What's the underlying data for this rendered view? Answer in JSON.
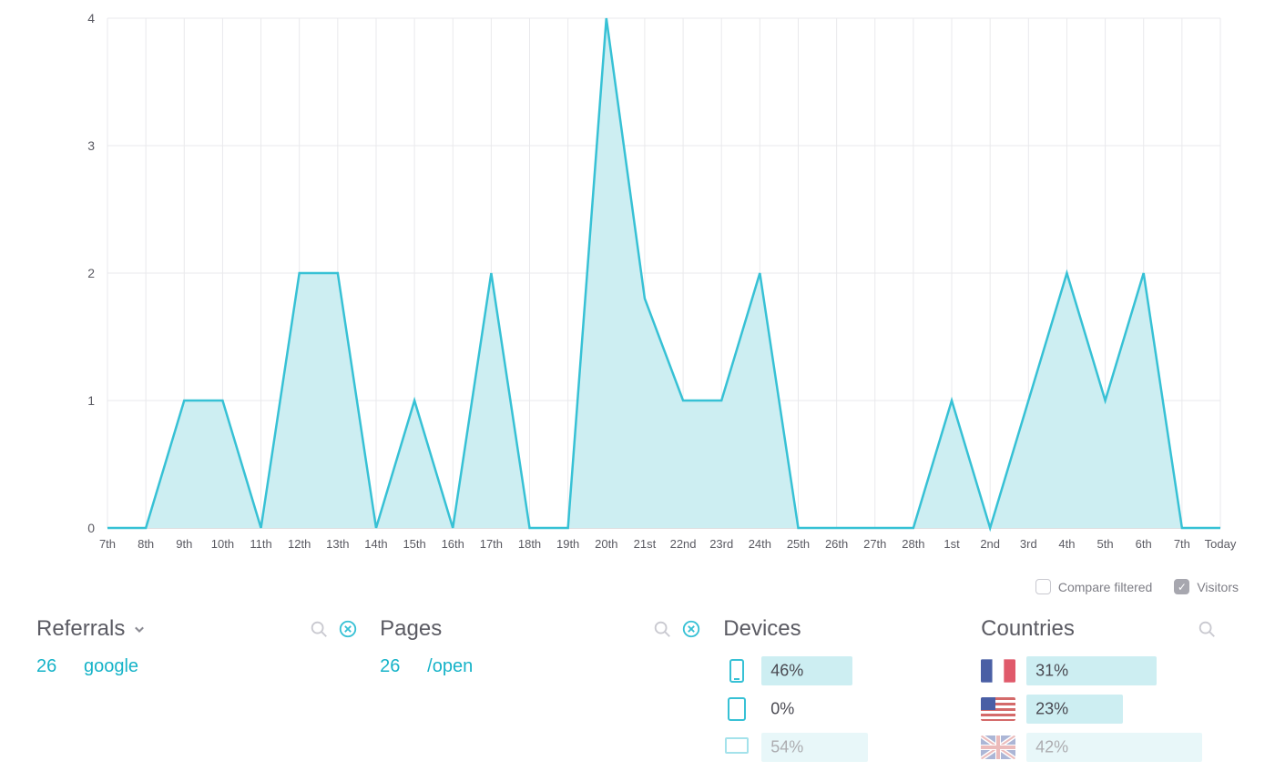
{
  "chart_data": {
    "type": "area",
    "title": "",
    "xlabel": "",
    "ylabel": "",
    "ylim": [
      0,
      4
    ],
    "yticks": [
      0,
      1,
      2,
      3,
      4
    ],
    "categories": [
      "7th",
      "8th",
      "9th",
      "10th",
      "11th",
      "12th",
      "13th",
      "14th",
      "15th",
      "16th",
      "17th",
      "18th",
      "19th",
      "20th",
      "21st",
      "22nd",
      "23rd",
      "24th",
      "25th",
      "26th",
      "27th",
      "28th",
      "1st",
      "2nd",
      "3rd",
      "4th",
      "5th",
      "6th",
      "7th",
      "Today"
    ],
    "values": [
      0,
      0,
      1,
      1,
      0,
      2,
      2,
      0,
      1,
      0,
      2,
      0,
      0,
      4,
      1.8,
      1,
      1,
      2,
      0,
      0,
      0,
      0,
      1,
      0,
      1,
      2,
      1,
      2,
      0,
      0
    ],
    "line_color": "#37c1d5",
    "fill_color": "#cdeef2"
  },
  "legend": {
    "compare": {
      "label": "Compare filtered",
      "checked": false
    },
    "visitors": {
      "label": "Visitors",
      "checked": true
    }
  },
  "panels": {
    "referrals": {
      "title": "Referrals",
      "items": [
        {
          "value": "26",
          "label": "google"
        }
      ]
    },
    "pages": {
      "title": "Pages",
      "items": [
        {
          "value": "26",
          "label": "/open"
        }
      ]
    },
    "devices": {
      "title": "Devices",
      "items": [
        {
          "icon": "mobile",
          "percent": 46,
          "label": "46%"
        },
        {
          "icon": "tablet",
          "percent": 0,
          "label": "0%"
        },
        {
          "icon": "desktop",
          "percent": 54,
          "label": "54%"
        }
      ]
    },
    "countries": {
      "title": "Countries",
      "items": [
        {
          "flag": "fr",
          "percent": 31,
          "label": "31%"
        },
        {
          "flag": "us",
          "percent": 23,
          "label": "23%"
        },
        {
          "flag": "gb",
          "percent": 42,
          "label": "42%"
        }
      ]
    }
  }
}
